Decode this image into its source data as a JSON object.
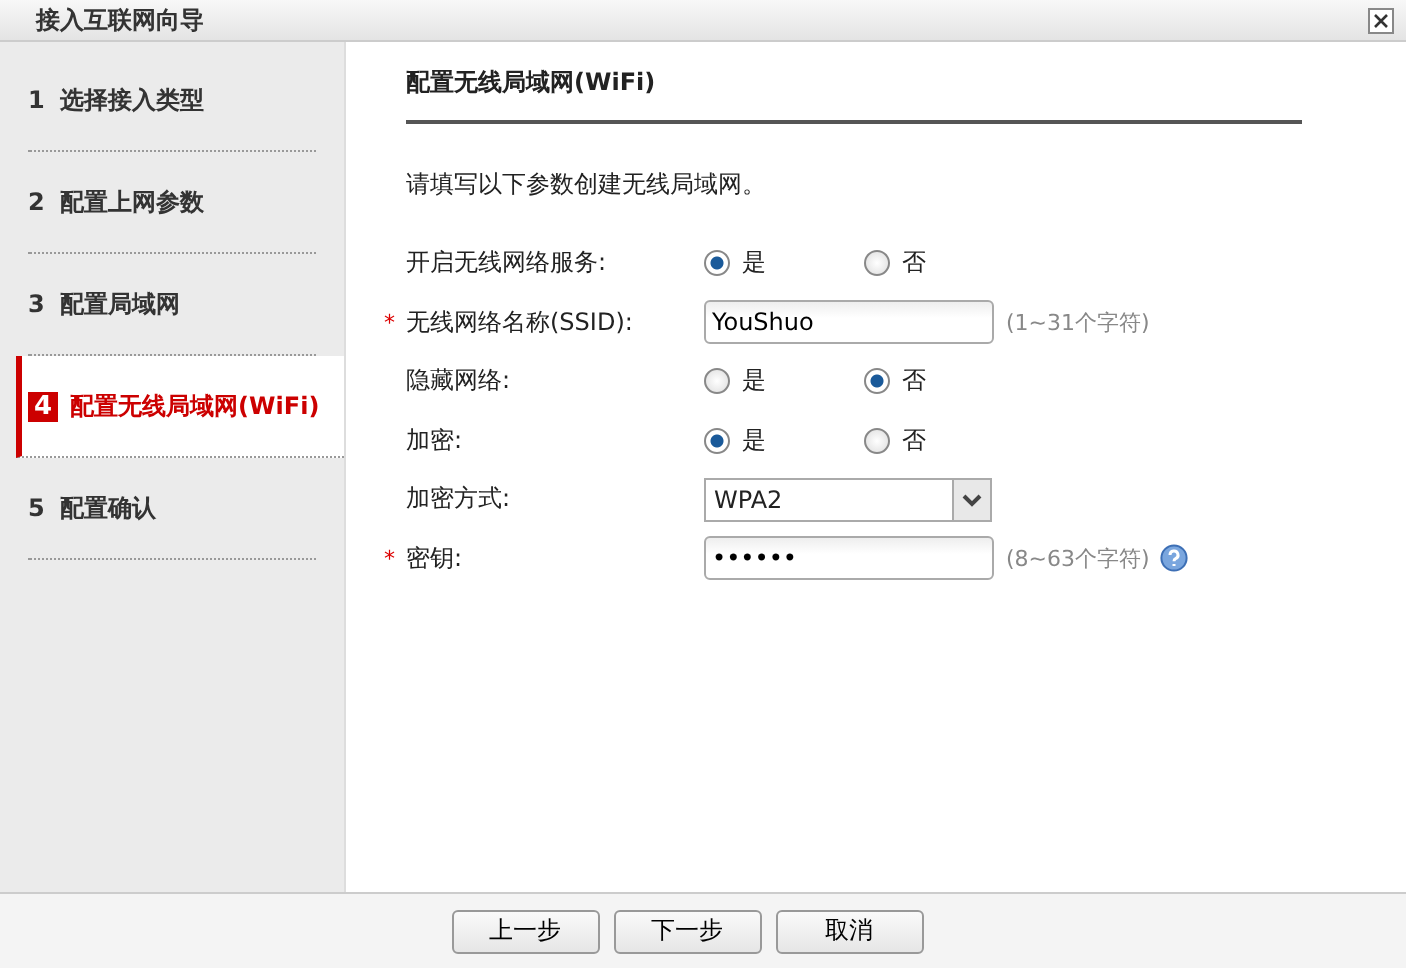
{
  "window": {
    "title": "接入互联网向导"
  },
  "steps": [
    {
      "number": "1",
      "label": "选择接入类型",
      "selected": false
    },
    {
      "number": "2",
      "label": "配置上网参数",
      "selected": false
    },
    {
      "number": "3",
      "label": "配置局域网",
      "selected": false
    },
    {
      "number": "4",
      "label": "配置无线局域网(WiFi)",
      "selected": true
    },
    {
      "number": "5",
      "label": "配置确认",
      "selected": false
    }
  ],
  "form": {
    "heading": "配置无线局域网(WiFi)",
    "intro": "请填写以下参数创建无线局域网。",
    "fields": [
      {
        "kind": "radio",
        "label": "开启无线网络服务:",
        "options": [
          {
            "label": "是",
            "selected": true
          },
          {
            "label": "否",
            "selected": false
          }
        ]
      },
      {
        "kind": "text",
        "label": "无线网络名称(SSID):",
        "marker": "*",
        "value": "YouShuo",
        "hint": "(1~31个字符)"
      },
      {
        "kind": "radio",
        "label": "隐藏网络:",
        "options": [
          {
            "label": "是",
            "selected": false
          },
          {
            "label": "否",
            "selected": true
          }
        ]
      },
      {
        "kind": "radio",
        "label": "加密:",
        "options": [
          {
            "label": "是",
            "selected": true
          },
          {
            "label": "否",
            "selected": false
          }
        ]
      },
      {
        "kind": "select",
        "label": "加密方式:",
        "value": "WPA2"
      },
      {
        "kind": "text",
        "label": "密钥:",
        "marker": "*",
        "value": "••••••",
        "hint": "(8~63个字符)",
        "help": true
      }
    ]
  },
  "buttons": [
    "上一步",
    "下一步",
    "取消"
  ]
}
